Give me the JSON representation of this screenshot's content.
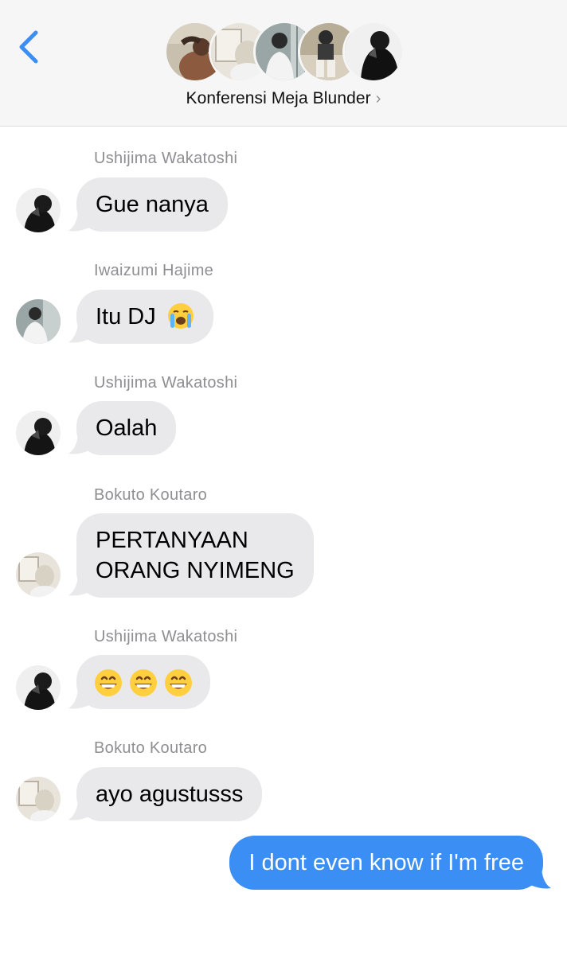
{
  "header": {
    "back_icon": "chevron-left-icon",
    "group_name": "Konferensi Meja Blunder",
    "chevron": "›",
    "member_avatar_count": 5
  },
  "colors": {
    "accent": "#3b8ef3",
    "incoming_bubble": "#e9e9eb",
    "sender_label": "#8e8e93"
  },
  "messages": [
    {
      "sender": "Ushijima Wakatoshi",
      "text": "Gue nanya"
    },
    {
      "sender": "Iwaizumi Hajime",
      "text": "Itu DJ",
      "emoji": "loudly-crying-face-icon"
    },
    {
      "sender": "Ushijima Wakatoshi",
      "text": "Oalah"
    },
    {
      "sender": "Bokuto Koutaro",
      "line1": "PERTANYAAN",
      "line2": "ORANG NYIMENG"
    },
    {
      "sender": "Ushijima Wakatoshi",
      "emoji": "grinning-face-icon",
      "emoji_count": 3
    },
    {
      "sender": "Bokuto Koutaro",
      "text": "ayo agustusss"
    }
  ],
  "outgoing": {
    "text": "I dont even know if I'm free"
  }
}
